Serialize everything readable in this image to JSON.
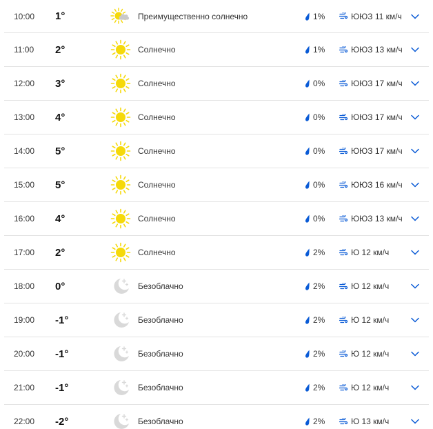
{
  "colors": {
    "sun": "#f5d90a",
    "moon": "#d9d9d9",
    "accent": "#0a5bd6",
    "divider": "#e3e3e3"
  },
  "rows": [
    {
      "time": "10:00",
      "temp": "1°",
      "icon": "partly-sunny-icon",
      "condition": "Преимущественно солнечно",
      "precip": "1%",
      "wind": "ЮЮЗ 11 км/ч"
    },
    {
      "time": "11:00",
      "temp": "2°",
      "icon": "sun-icon",
      "condition": "Солнечно",
      "precip": "1%",
      "wind": "ЮЮЗ 13 км/ч"
    },
    {
      "time": "12:00",
      "temp": "3°",
      "icon": "sun-icon",
      "condition": "Солнечно",
      "precip": "0%",
      "wind": "ЮЮЗ 17 км/ч"
    },
    {
      "time": "13:00",
      "temp": "4°",
      "icon": "sun-icon",
      "condition": "Солнечно",
      "precip": "0%",
      "wind": "ЮЮЗ 17 км/ч"
    },
    {
      "time": "14:00",
      "temp": "5°",
      "icon": "sun-icon",
      "condition": "Солнечно",
      "precip": "0%",
      "wind": "ЮЮЗ 17 км/ч"
    },
    {
      "time": "15:00",
      "temp": "5°",
      "icon": "sun-icon",
      "condition": "Солнечно",
      "precip": "0%",
      "wind": "ЮЮЗ 16 км/ч"
    },
    {
      "time": "16:00",
      "temp": "4°",
      "icon": "sun-icon",
      "condition": "Солнечно",
      "precip": "0%",
      "wind": "ЮЮЗ 13 км/ч"
    },
    {
      "time": "17:00",
      "temp": "2°",
      "icon": "sun-icon",
      "condition": "Солнечно",
      "precip": "2%",
      "wind": "Ю 12 км/ч"
    },
    {
      "time": "18:00",
      "temp": "0°",
      "icon": "moon-icon",
      "condition": "Безоблачно",
      "precip": "2%",
      "wind": "Ю 12 км/ч"
    },
    {
      "time": "19:00",
      "temp": "-1°",
      "icon": "moon-icon",
      "condition": "Безоблачно",
      "precip": "2%",
      "wind": "Ю 12 км/ч"
    },
    {
      "time": "20:00",
      "temp": "-1°",
      "icon": "moon-icon",
      "condition": "Безоблачно",
      "precip": "2%",
      "wind": "Ю 12 км/ч"
    },
    {
      "time": "21:00",
      "temp": "-1°",
      "icon": "moon-icon",
      "condition": "Безоблачно",
      "precip": "2%",
      "wind": "Ю 12 км/ч"
    },
    {
      "time": "22:00",
      "temp": "-2°",
      "icon": "moon-icon",
      "condition": "Безоблачно",
      "precip": "2%",
      "wind": "Ю 13 км/ч"
    }
  ]
}
